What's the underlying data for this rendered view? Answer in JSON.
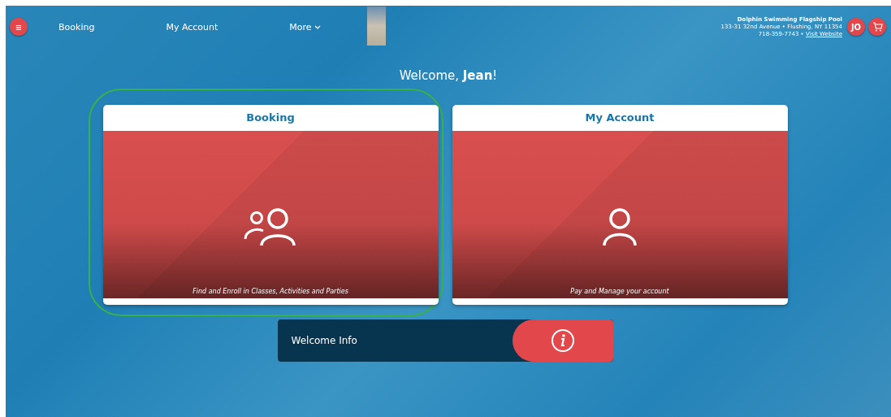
{
  "nav": {
    "menu_button": "≡",
    "links": [
      "Booking",
      "My Account",
      "More"
    ]
  },
  "venue": {
    "name": "Dolphin Swimming Flagship Pool",
    "address": "133-31 32nd Avenue • Flushing, NY 11354",
    "phone": "718-359-7743 •",
    "website_link": "Visit Website"
  },
  "user_badge": "JO",
  "welcome": "Welcome, **Jean**!",
  "tiles": [
    {
      "title": "Booking",
      "kind": "group",
      "caption": "Find and Enroll in Classes, Activities and Parties",
      "highlighted": true
    },
    {
      "title": "My Account",
      "kind": "person",
      "caption": "Pay and Manage your account",
      "highlighted": false
    }
  ],
  "info_bar": {
    "label": "Welcome Info"
  }
}
